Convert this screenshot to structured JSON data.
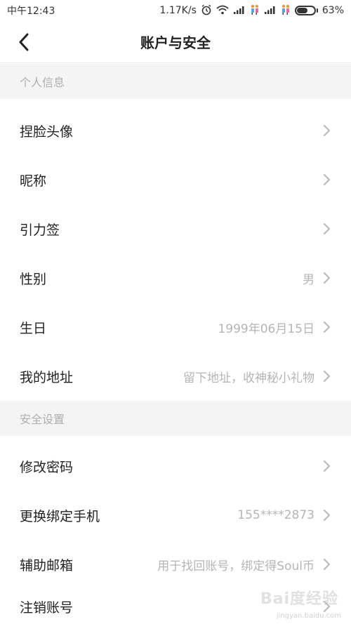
{
  "status_bar": {
    "time": "中午12:43",
    "speed": "1.17K/s",
    "battery": "63%",
    "battery_level": 0.63
  },
  "header": {
    "title": "账户与安全"
  },
  "sections": {
    "personal": {
      "title": "个人信息",
      "items": [
        {
          "label": "捏脸头像",
          "value": ""
        },
        {
          "label": "昵称",
          "value": ""
        },
        {
          "label": "引力签",
          "value": ""
        },
        {
          "label": "性别",
          "value": "男"
        },
        {
          "label": "生日",
          "value": "1999年06月15日"
        },
        {
          "label": "我的地址",
          "value": "留下地址，收神秘小礼物"
        }
      ]
    },
    "security": {
      "title": "安全设置",
      "items": [
        {
          "label": "修改密码",
          "value": ""
        },
        {
          "label": "更换绑定手机",
          "value": "155****2873"
        },
        {
          "label": "辅助邮箱",
          "value": "用于找回账号，绑定得Soul币"
        },
        {
          "label": "注销账号",
          "value": ""
        }
      ]
    }
  },
  "watermark": {
    "brand": "Bai度经验",
    "url": "jingyan.baidu.com"
  },
  "icons": [
    "alarm-icon",
    "wifi-icon",
    "signal-icon",
    "couple-icon",
    "battery-icon",
    "back-chevron-icon",
    "chevron-right-icon"
  ]
}
